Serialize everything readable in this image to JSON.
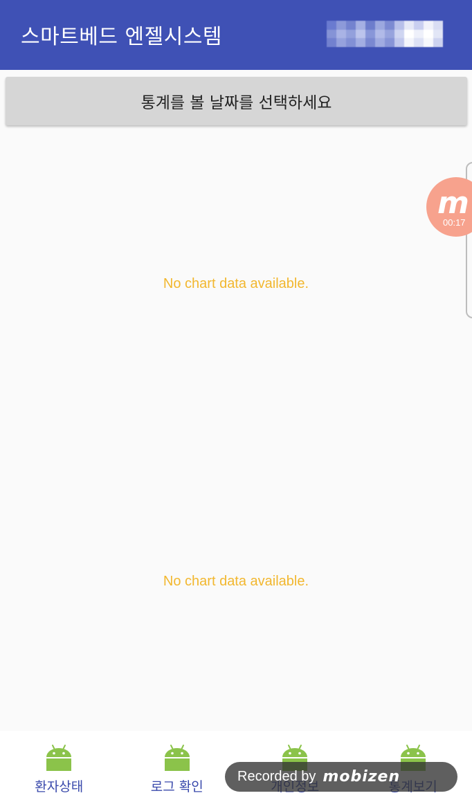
{
  "appbar": {
    "title": "스마트베드 엔젤시스템",
    "user_blurred": true,
    "color": "#3f51b5"
  },
  "date_button": {
    "label": "통계를 볼 날짜를 선택하세요"
  },
  "charts": [
    {
      "empty_message": "No chart data available."
    },
    {
      "empty_message": "No chart data available."
    }
  ],
  "overlay": {
    "bubble_icon": "m",
    "timer": "00:17",
    "recorded_text": "Recorded by",
    "recorded_brand": "mobizen"
  },
  "bottom_nav": {
    "items": [
      {
        "label": "환자상태",
        "icon": "android-icon"
      },
      {
        "label": "로그 확인",
        "icon": "android-icon"
      },
      {
        "label": "개인정보",
        "icon": "android-icon"
      },
      {
        "label": "통계보기",
        "icon": "android-icon"
      }
    ]
  },
  "colors": {
    "accent": "#3f51b5",
    "nav_label": "#3949ab",
    "empty_chart_text": "#f2b72e",
    "android_green": "#8bc34a"
  }
}
